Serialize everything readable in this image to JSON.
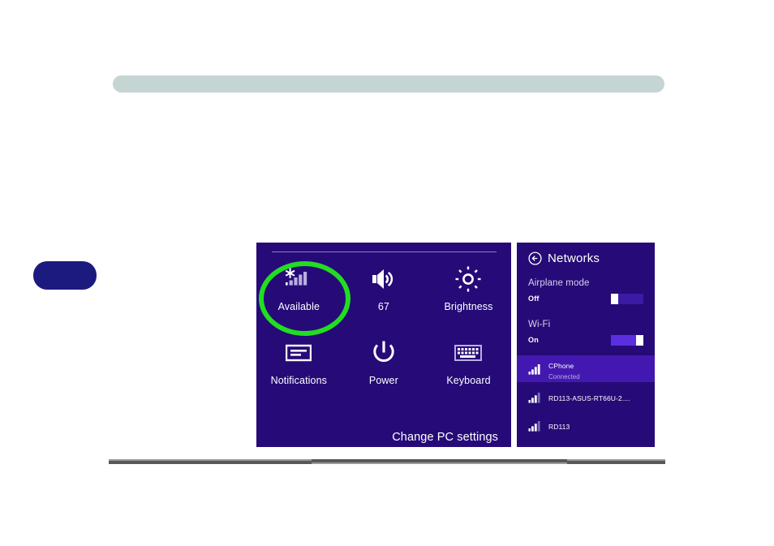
{
  "page": {
    "background_color": "#ffffff",
    "top_banner_color": "#c4d5d3",
    "side_tab_color": "#1c1a7e",
    "bottom_rule_color": "#585858"
  },
  "highlight": {
    "color": "#22dd22",
    "target": "Available"
  },
  "settings_panel": {
    "background_color": "#260a78",
    "tiles": [
      {
        "icon": "wifi-signal-icon",
        "label": "Available"
      },
      {
        "icon": "volume-speaker-icon",
        "label": "67"
      },
      {
        "icon": "brightness-sun-icon",
        "label": "Brightness"
      },
      {
        "icon": "notifications-icon",
        "label": "Notifications"
      },
      {
        "icon": "power-icon",
        "label": "Power"
      },
      {
        "icon": "keyboard-icon",
        "label": "Keyboard"
      }
    ],
    "change_pc_settings_label": "Change PC settings"
  },
  "networks_panel": {
    "background_color": "#260a78",
    "back_icon": "back-arrow-circle-icon",
    "title": "Networks",
    "settings": [
      {
        "name": "Airplane mode",
        "state": "Off",
        "on": false
      },
      {
        "name": "Wi-Fi",
        "state": "On",
        "on": true
      }
    ],
    "networks": [
      {
        "ssid": "CPhone",
        "status": "Connected",
        "selected": true,
        "bars": 4,
        "icon": "wifi-bars-icon"
      },
      {
        "ssid": "RD113-ASUS-RT66U-2....",
        "status": "",
        "selected": false,
        "bars": 3,
        "icon": "wifi-bars-icon"
      },
      {
        "ssid": "RD113",
        "status": "",
        "selected": false,
        "bars": 3,
        "icon": "wifi-bars-icon"
      }
    ],
    "selected_row_color": "#4318b0"
  }
}
